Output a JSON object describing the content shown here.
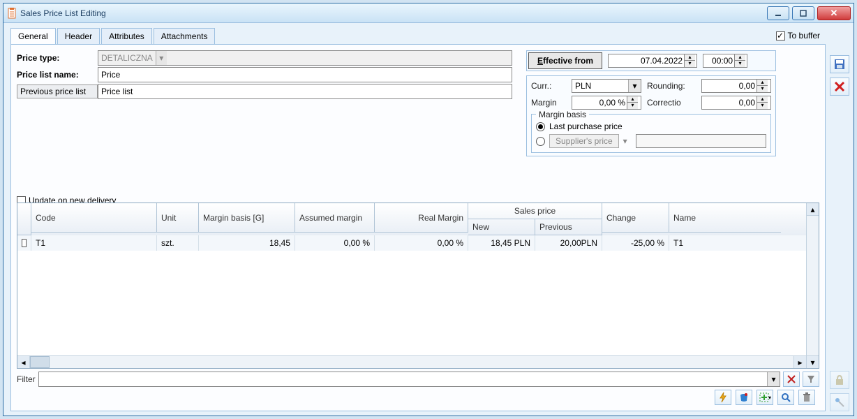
{
  "window": {
    "title": "Sales Price List Editing"
  },
  "tabs": [
    "General",
    "Header",
    "Attributes",
    "Attachments"
  ],
  "to_buffer": {
    "label": "To buffer",
    "checked": true
  },
  "form": {
    "price_type_label": "Price type:",
    "price_type_value": "DETALICZNA",
    "price_list_name_label": "Price list name:",
    "price_list_name_value": "Price",
    "previous_price_list_button": "Previous price list",
    "previous_price_list_value": "Price list"
  },
  "effective": {
    "label": "Effective from",
    "date": "07.04.2022",
    "time": "00:00"
  },
  "params": {
    "curr_label": "Curr.:",
    "curr_value": "PLN",
    "rounding_label": "Rounding:",
    "rounding_value": "0,00",
    "margin_label": "Margin",
    "margin_value": "0,00 %",
    "correction_label": "Correctio",
    "correction_value": "0,00"
  },
  "margin_basis": {
    "legend": "Margin basis",
    "last_purchase": "Last purchase price",
    "supplier_price": "Supplier's price",
    "selected": "last_purchase"
  },
  "update_on_new_delivery": {
    "label": "Update on new delivery",
    "checked": false
  },
  "table": {
    "headers": {
      "code": "Code",
      "unit": "Unit",
      "margin_basis": "Margin basis [G]",
      "assumed_margin": "Assumed margin",
      "real_margin": "Real Margin",
      "sales_price_group": "Sales price",
      "new": "New",
      "previous": "Previous",
      "change": "Change",
      "name": "Name"
    },
    "rows": [
      {
        "code": "T1",
        "unit": "szt.",
        "margin_basis": "18,45",
        "assumed_margin": "0,00 %",
        "real_margin": "0,00 %",
        "new": "18,45 PLN",
        "previous": "20,00PLN",
        "change": "-25,00 %",
        "name": "T1"
      }
    ]
  },
  "filter": {
    "label": "Filter",
    "value": ""
  }
}
